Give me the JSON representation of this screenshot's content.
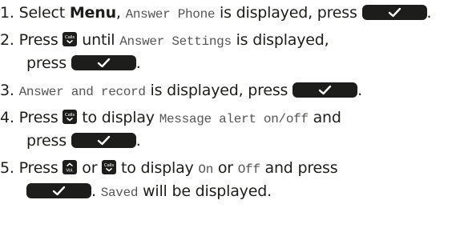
{
  "icons": {
    "ok_key": "check-icon",
    "down_key": "calls-down-icon",
    "up_key": "vol-up-icon",
    "key_color": "#1d1d1b",
    "display_text_color": "#555555"
  },
  "steps": [
    {
      "num": "1.",
      "t1": "Select ",
      "bold": "Menu",
      "t2": ", ",
      "lcd": "Answer Phone",
      "t3": " is displayed, press ",
      "t4": "."
    },
    {
      "num": "2.",
      "t1": "Press ",
      "t2": " until ",
      "lcd": "Answer Settings",
      "t3": " is displayed,",
      "t4": "press ",
      "t5": "."
    },
    {
      "num": "3.",
      "lcd": "Answer and record",
      "t1": " is displayed, press ",
      "t2": "."
    },
    {
      "num": "4.",
      "t1": "Press ",
      "t2": " to display ",
      "lcd": "Message alert on/off",
      "t3": " and",
      "t4": "press ",
      "t5": "."
    },
    {
      "num": "5.",
      "t1": "Press ",
      "t2": " or ",
      "t3": " to display ",
      "lcd1": "On",
      "t4": " or ",
      "lcd2": "Off",
      "t5": " and press",
      "t6": ". ",
      "lcd3": "Saved",
      "t7": " will be displayed."
    }
  ]
}
